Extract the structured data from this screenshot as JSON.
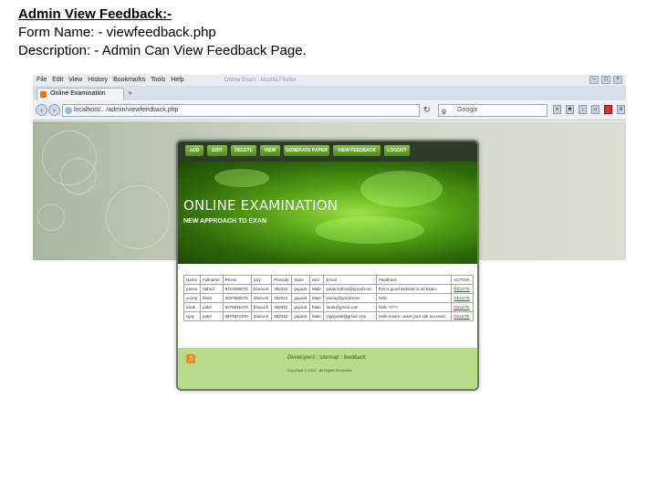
{
  "slide": {
    "title": "Admin View Feedback:-",
    "form_name": "Form Name: - viewfeedback.php",
    "description": "Description: - Admin Can View Feedback Page."
  },
  "browser": {
    "menu": [
      "File",
      "Edit",
      "View",
      "History",
      "Bookmarks",
      "Tools",
      "Help"
    ],
    "window_title": "Online Exam - Mozilla Firefox",
    "tab_label": "Online Examination",
    "url": "localhost/.../admin/viewfeedback.php",
    "search_placeholder": "Google",
    "new_tab": "+",
    "reload": "↻"
  },
  "site": {
    "nav": [
      "ADD",
      "EDIT",
      "DELETE",
      "VIEW",
      "GENERATE PAPER",
      "VIEW FEEDBACK",
      "LOGOUT"
    ],
    "heading": "ONLINE EXAMINATION",
    "subheading": "NEW APPROACH TO EXAN",
    "table": {
      "headers": [
        "Name",
        "Fullname",
        "Phone",
        "City",
        "Pincode",
        "State",
        "Sex",
        "Email",
        "Feedback",
        "ACTION"
      ],
      "rows": [
        [
          "pavan",
          "rathod",
          "9313288276",
          "bharuch",
          "392012",
          "gujarat",
          "Male",
          "pavanrathod@gmail.com",
          "this is good website to do exam.",
          "DELETE"
        ],
        [
          "yuvraj",
          "bhatt",
          "9327688276",
          "bharuch",
          "392012",
          "gujarat",
          "Male",
          "yuvraj@gmail.com",
          "hello",
          "DELETE"
        ],
        [
          "tarak",
          "patel",
          "9278845378",
          "bharuch",
          "392012",
          "gujarat",
          "Male",
          "tarak@gmail.com",
          "hello ????",
          "DELETE"
        ],
        [
          "vijay",
          "patel",
          "9274872370",
          "bharuch",
          "392012",
          "gujarat",
          "Male",
          "vijaypatel@gmail.com",
          "hello maam i want your site succeed.",
          "DELETE"
        ]
      ]
    },
    "footer": {
      "developers": "Developers : sitemap : feedback",
      "copyright": "Copyright © 2014 - All Rights Reserved."
    }
  },
  "colors": {
    "nav_button": "#6fae2d",
    "hero_green": "#58a418",
    "footer_green": "#b7dc8a",
    "delete_link": "#2d6e10"
  }
}
